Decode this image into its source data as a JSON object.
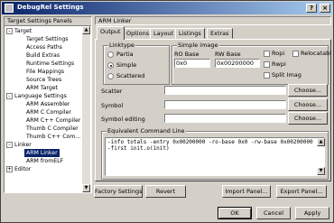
{
  "window": {
    "title": "DebugRel Settings",
    "help_label": "?",
    "close_label": "×"
  },
  "tree": {
    "header": "Target Settings Panels",
    "items": [
      {
        "label": "Target",
        "expand": "-"
      },
      {
        "label": "Target Settings"
      },
      {
        "label": "Access Paths"
      },
      {
        "label": "Build Extras"
      },
      {
        "label": "Runtime Settings"
      },
      {
        "label": "File Mappings"
      },
      {
        "label": "Source Trees"
      },
      {
        "label": "ARM Target"
      },
      {
        "label": "Language Settings",
        "expand": "-"
      },
      {
        "label": "ARM Assembler"
      },
      {
        "label": "ARM C Compiler"
      },
      {
        "label": "ARM C++ Compiler"
      },
      {
        "label": "Thumb C Compiler"
      },
      {
        "label": "Thumb C++ Com..."
      },
      {
        "label": "Linker",
        "expand": "-"
      },
      {
        "label": "ARM Linker",
        "selected": true
      },
      {
        "label": "ARM fromELF"
      },
      {
        "label": "Editor",
        "expand": "+"
      }
    ]
  },
  "panel": {
    "header": "ARM Linker",
    "tabs": [
      "Output",
      "Options",
      "Layout",
      "Listings",
      "Extras"
    ],
    "active_tab": "Output",
    "linktype": {
      "label": "Linktype",
      "options": [
        "Partia",
        "Simple",
        "Scattered"
      ],
      "selected": "Simple"
    },
    "simple_image": {
      "label": "Simple image",
      "ro_base_label": "RO Base",
      "ro_base_value": "0x0",
      "rw_base_label": "RW Base",
      "rw_base_value": "0x00200000",
      "ropi_label": "Ropi",
      "rwpi_label": "Rwpi",
      "split_label": "Split Imag",
      "reloc_label": "Relocatabl"
    },
    "scatter_label": "Scatter",
    "symbol_label": "Symbol",
    "symbol_editing_label": "Symbol editing",
    "choose_label": "Choose...",
    "equiv_label": "Equivalent Command Line",
    "command_line": [
      "-info totals -entry 0x00200000 -ro-base 0x0 -rw-base 0x00200000",
      "-first init.o(init)"
    ]
  },
  "buttons": {
    "factory": "Factory Settings",
    "revert": "Revert",
    "import": "Import Panel...",
    "export": "Export Panel...",
    "ok": "OK",
    "cancel": "Cancel",
    "apply": "Apply"
  }
}
